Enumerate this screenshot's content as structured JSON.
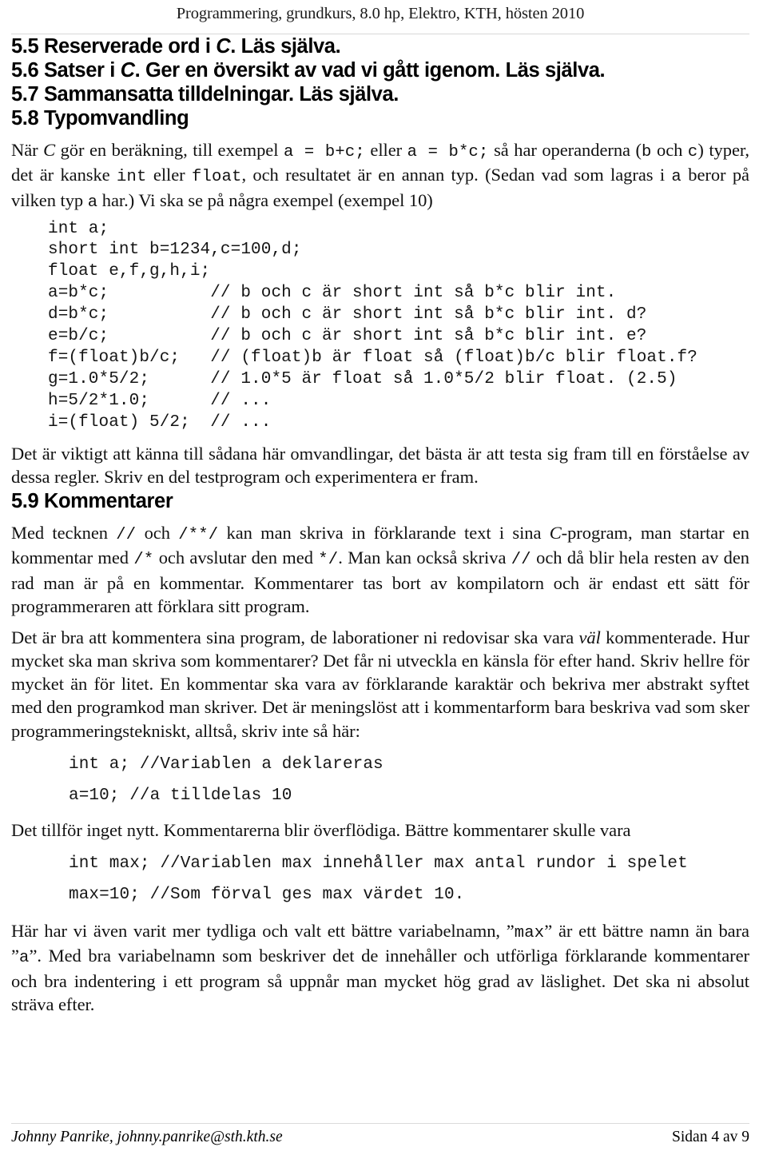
{
  "header": {
    "course_line": "Programmering, grundkurs, 8.0 hp, Elektro, KTH, hösten 2010"
  },
  "sections": {
    "s55": {
      "number": "5.5",
      "title_pre": "Reserverade ord i ",
      "title_ital": "C",
      "title_post": ". Läs själva."
    },
    "s56": {
      "number": "5.6",
      "title_pre": "Satser i ",
      "title_ital": "C",
      "title_post": ". Ger en översikt av vad vi gått igenom. Läs själva."
    },
    "s57": {
      "number": "5.7",
      "title_plain": "Sammansatta tilldelningar. Läs själva."
    },
    "s58": {
      "number": "5.8",
      "title_plain": "Typomvandling"
    },
    "s59": {
      "number": "5.9",
      "title_plain": "Kommentarer"
    }
  },
  "typomvandling": {
    "intro": {
      "p1_a": "När ",
      "p1_c": "C",
      "p1_b": " gör en beräkning, till exempel ",
      "code1": "a = b+c;",
      "p1_c2": " eller ",
      "code2": "a = b*c;",
      "p1_d": " så har operanderna (",
      "code3": "b",
      "p1_e": " och ",
      "code4": "c",
      "p1_f": ") typer, det är kanske ",
      "code5": "int",
      "p1_g": " eller ",
      "code6": "float",
      "p1_h": ", och resultatet är en annan typ. (Sedan vad som lagras i ",
      "code7": "a",
      "p1_i": " beror på vilken typ ",
      "code8": "a",
      "p1_j": " har.) Vi ska se på några exempel (exempel 10)"
    },
    "code_example": "int a;\nshort int b=1234,c=100,d;\nfloat e,f,g,h,i;\na=b*c;          // b och c är short int så b*c blir int.\nd=b*c;          // b och c är short int så b*c blir int. d?\ne=b/c;          // b och c är short int så b*c blir int. e?\nf=(float)b/c;   // (float)b är float så (float)b/c blir float.f?\ng=1.0*5/2;      // 1.0*5 är float så 1.0*5/2 blir float. (2.5)\nh=5/2*1.0;      // ...\ni=(float) 5/2;  // ...",
    "after_code": "Det är viktigt att känna till sådana här omvandlingar, det bästa är att testa sig fram till en förståelse av dessa regler. Skriv en del testprogram och experimentera er fram."
  },
  "kommentarer": {
    "p1_a": "Med tecknen ",
    "p1_code1": "//",
    "p1_b": " och ",
    "p1_code2": "/**/",
    "p1_c": " kan man skriva in förklarande text i sina ",
    "p1_ital": "C",
    "p1_d": "-program, man startar en kommentar med ",
    "p1_code3": "/*",
    "p1_e": " och avslutar den med ",
    "p1_code4": "*/",
    "p1_f": ". Man kan också skriva ",
    "p1_code5": "//",
    "p1_g": " och då blir hela resten av den rad man är på en kommentar. Kommentarer tas bort av kompilatorn och är endast ett sätt för programmeraren att förklara sitt program.",
    "p2_a": "Det är bra att kommentera sina program, de laborationer ni redovisar ska vara ",
    "p2_ital": "väl",
    "p2_b": " kommenterade. Hur mycket ska man skriva som kommentarer? Det får ni utveckla en känsla för efter hand. Skriv hellre för mycket än för litet. En kommentar ska vara av förklarande karaktär och bekriva mer abstrakt syftet med den programkod man skriver. Det är meningslöst att i kommentarform bara beskriva vad som sker programmeringstekniskt, alltså, skriv inte så här:",
    "bad_example": "int a; //Variablen a deklareras\na=10; //a tilldelas 10",
    "between": "Det tillför inget nytt. Kommentarerna blir överflödiga. Bättre kommentarer skulle vara",
    "good_example": "int max; //Variablen max innehåller max antal rundor i spelet\nmax=10; //Som förval ges max värdet 10.",
    "p3_a": "Här har vi även varit mer tydliga och valt ett bättre variabelnamn, ”",
    "p3_code1": "max",
    "p3_b": "” är ett bättre namn än bara ”",
    "p3_code2": "a",
    "p3_c": "”. Med bra variabelnamn som beskriver det de innehåller och utförliga förklarande kommentarer och bra indentering i ett program så uppnår man mycket hög grad av läslighet. Det ska ni absolut sträva efter."
  },
  "footer": {
    "author": "Johnny Panrike, johnny.panrike@sth.kth.se",
    "page": "Sidan 4 av 9"
  }
}
